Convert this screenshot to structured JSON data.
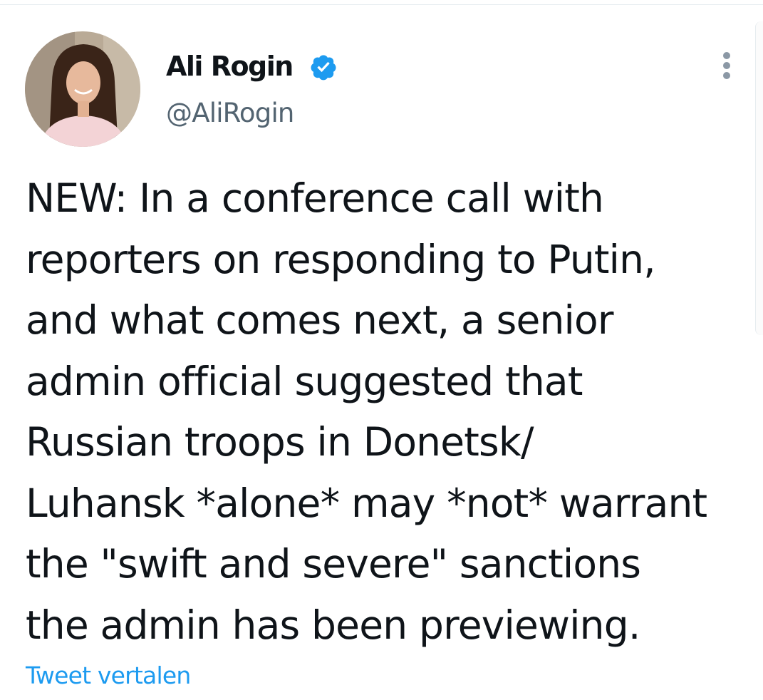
{
  "author": {
    "display_name": "Ali Rogin",
    "handle": "@AliRogin",
    "verified": true,
    "verified_icon": "verified-badge-icon",
    "avatar_icon": "avatar-photo"
  },
  "tweet": {
    "text": "NEW: In a conference call with\nreporters on responding to Putin,\nand what comes next, a senior\nadmin official suggested that\nRussian troops in Donetsk/\nLuhansk *alone* may *not* warrant\nthe \"swift and severe\" sanctions\nthe admin has been previewing."
  },
  "actions": {
    "translate_label": "Tweet vertalen",
    "more_icon": "more-vertical-icon"
  },
  "colors": {
    "accent": "#1d9bf0",
    "text": "#0f1419",
    "secondary_text": "#536471"
  }
}
